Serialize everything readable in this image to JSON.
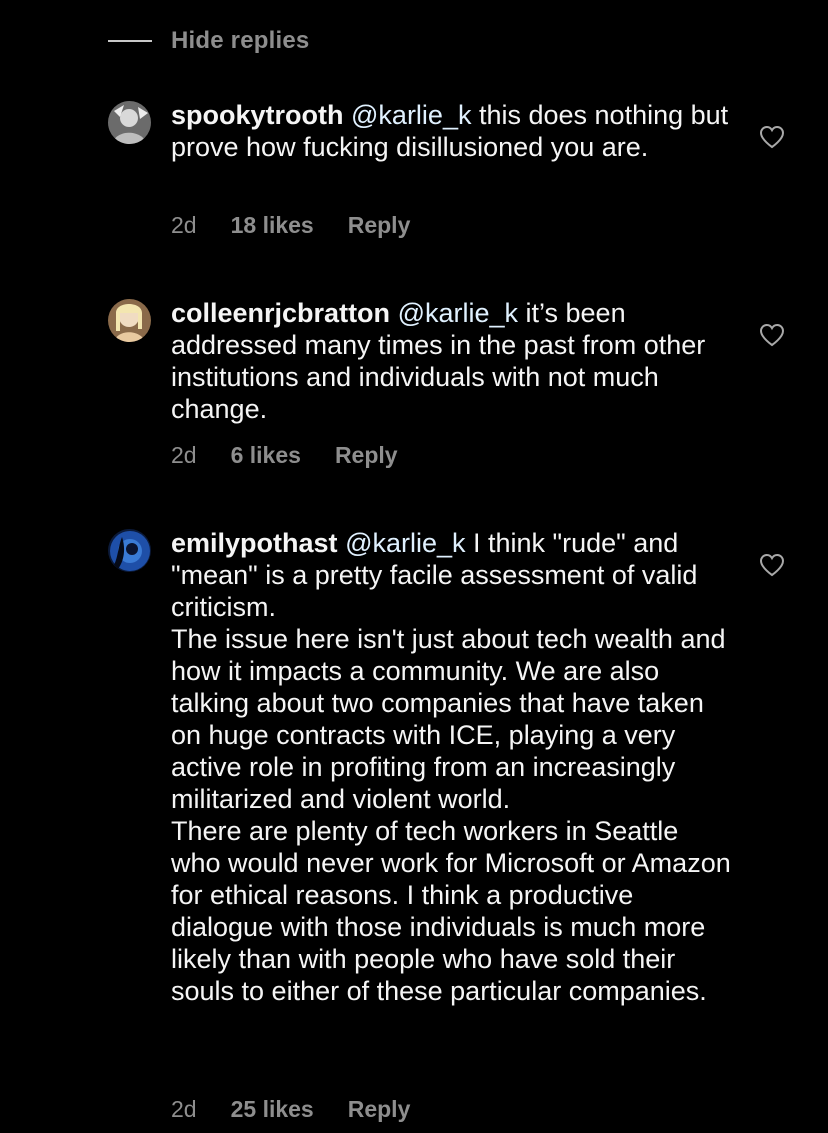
{
  "hide_replies": {
    "label": "Hide replies"
  },
  "comments": [
    {
      "username": "spookytrooth",
      "mention": "@karlie_k",
      "paragraphs": [
        " this does nothing but prove how fucking disillusioned you are."
      ],
      "time": "2d",
      "likes": "18 likes",
      "reply": "Reply",
      "avatar_colors": [
        "#d8d8d8",
        "#5a5a5a"
      ]
    },
    {
      "username": "colleenrjcbratton",
      "mention": "@karlie_k",
      "paragraphs": [
        " it’s been addressed many times in the past from other institutions and individuals with not much change."
      ],
      "time": "2d",
      "likes": "6 likes",
      "reply": "Reply",
      "avatar_colors": [
        "#e6d3b8",
        "#8a6a4a"
      ]
    },
    {
      "username": "emilypothast",
      "mention": "@karlie_k",
      "paragraphs": [
        " I think \"rude\" and \"mean\" is a pretty facile assessment of valid criticism.",
        "The issue here isn't just about tech wealth and how it impacts a community. We are also talking about two companies that have taken on huge contracts with ICE, playing a very active role in profiting from an increasingly militarized and violent world.",
        "There are plenty of tech workers in Seattle who would never work for Microsoft or Amazon for ethical reasons. I think a productive dialogue with those individuals is much more likely than with people who have sold their souls to either of these particular companies."
      ],
      "time": "2d",
      "likes": "25 likes",
      "reply": "Reply",
      "avatar_colors": [
        "#3a7bd5",
        "#0b1a3a"
      ]
    }
  ],
  "colors": {
    "background": "#000000",
    "text": "#f5f5f5",
    "muted": "#8e8e8e",
    "mention": "#e0f1ff"
  },
  "icons": {
    "like": "heart-outline-icon"
  }
}
